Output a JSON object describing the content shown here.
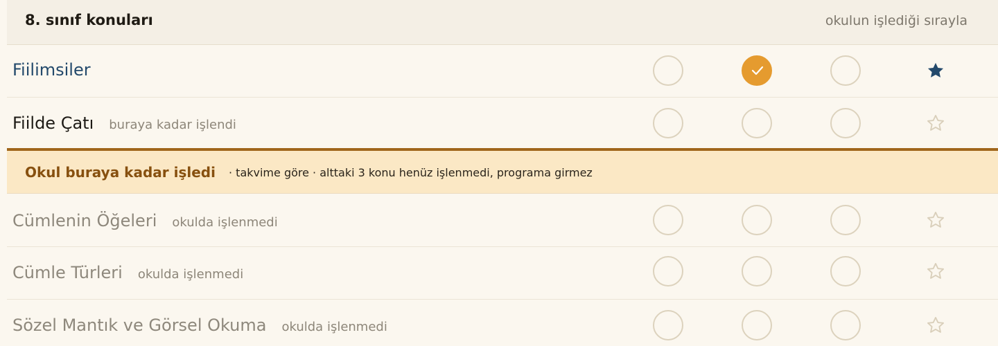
{
  "header": {
    "title": "8. sınıf konuları",
    "subtitle": "okulun işlediği sırayla"
  },
  "topics": [
    {
      "name": "Fiilimsiler",
      "note": "",
      "state": "active",
      "selected": 1,
      "starred": true
    },
    {
      "name": "Fiilde Çatı",
      "note": "buraya kadar işlendi",
      "state": "done",
      "selected": -1,
      "starred": false
    },
    {
      "name": "Cümlenin Öğeleri",
      "note": "okulda işlenmedi",
      "state": "dim",
      "selected": -1,
      "starred": false
    },
    {
      "name": "Cümle Türleri",
      "note": "okulda işlenmedi",
      "state": "dim",
      "selected": -1,
      "starred": false
    },
    {
      "name": "Sözel Mantık ve Görsel Okuma",
      "note": "okulda işlenmedi",
      "state": "dim",
      "selected": -1,
      "starred": false
    }
  ],
  "banner": {
    "title": "Okul buraya kadar işledi",
    "note": "· takvime göre · alttaki 3 konu henüz işlenmedi, programa girmez"
  },
  "colors": {
    "accent": "#e59b2f",
    "active_text": "#23496b",
    "star_filled": "#23496b",
    "star_outline": "#d9cfba",
    "banner_bg": "#fbe8c5",
    "banner_border": "#a0661b"
  }
}
